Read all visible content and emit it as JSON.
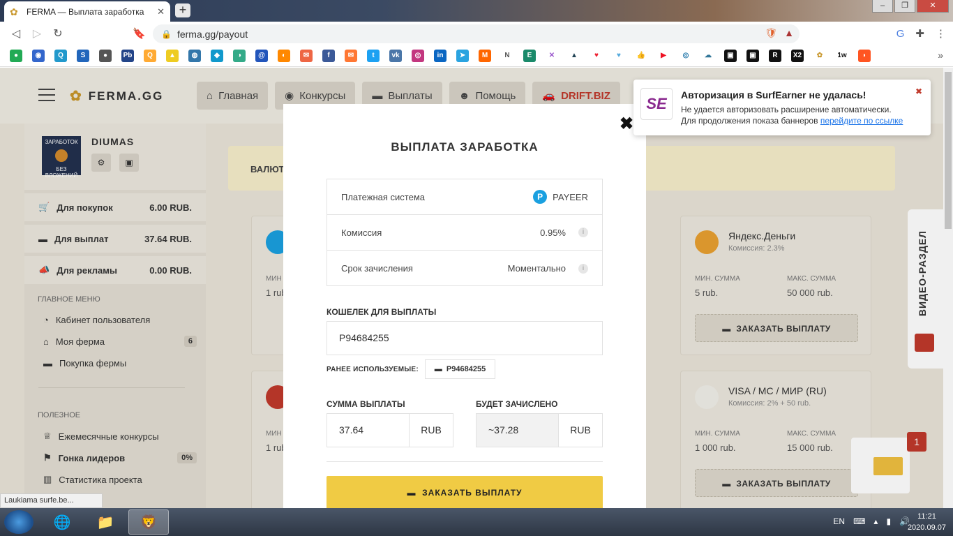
{
  "browser": {
    "tab_title": "FERMA — Выплата заработка",
    "url": "ferma.gg/payout",
    "status_text": "Laukiama surfe.be...",
    "brave_badge": "1"
  },
  "site": {
    "logo": "FERMA.GG",
    "nav": [
      "Главная",
      "Конкурсы",
      "Выплаты",
      "Помощь",
      "DRIFT.BIZ"
    ]
  },
  "sidebar": {
    "username": "DIUMAS",
    "avatar_text": "ЗАРАБОТОК",
    "avatar_sub": "БЕЗ ВЛОЖЕНИЙ",
    "balances": [
      {
        "label": "Для покупок",
        "value": "6.00 RUB."
      },
      {
        "label": "Для выплат",
        "value": "37.64 RUB."
      },
      {
        "label": "Для рекламы",
        "value": "0.00 RUB."
      }
    ],
    "main_menu_head": "ГЛАВНОЕ МЕНЮ",
    "main_menu": [
      {
        "label": "Кабинет пользователя",
        "badge": ""
      },
      {
        "label": "Моя ферма",
        "badge": "6"
      },
      {
        "label": "Покупка фермы",
        "badge": ""
      }
    ],
    "useful_head": "ПОЛЕЗНОЕ",
    "useful": [
      {
        "label": "Ежемесячные конкурсы",
        "badge": ""
      },
      {
        "label": "Гонка лидеров",
        "badge": "0%"
      },
      {
        "label": "Статистика проекта",
        "badge": ""
      }
    ]
  },
  "content": {
    "currency_label": "ВАЛЮТ",
    "cards": [
      {
        "name": "Яндекс.Деньги",
        "fee": "Комиссия: 2.3%",
        "min_label": "МИН. СУММА",
        "min": "5 rub.",
        "max_label": "МАКС. СУММА",
        "max": "50 000 rub.",
        "button": "ЗАКАЗАТЬ ВЫПЛАТУ"
      },
      {
        "name": "VISA / MC / МИР (RU)",
        "fee": "Комиссия: 2% + 50 rub.",
        "min_label": "МИН. СУММА",
        "min": "1 000 rub.",
        "max_label": "МАКС. СУММА",
        "max": "15 000 rub.",
        "button": "ЗАКАЗАТЬ ВЫПЛАТУ"
      }
    ],
    "partial_cards": [
      {
        "min_label": "МИН",
        "min": "1 rub"
      },
      {
        "min_label": "МИН",
        "min": "1 rub"
      }
    ],
    "video_tab": "ВИДЕО-РАЗДЕЛ",
    "message_count": "1"
  },
  "modal": {
    "title": "ВЫПЛАТА ЗАРАБОТКА",
    "rows": [
      {
        "key": "Платежная система",
        "value": "PAYEER"
      },
      {
        "key": "Комиссия",
        "value": "0.95%"
      },
      {
        "key": "Срок зачисления",
        "value": "Моментально"
      }
    ],
    "wallet_label": "КОШЕЛЕК ДЛЯ ВЫПЛАТЫ",
    "wallet_value": "P94684255",
    "prev_label": "РАНЕЕ ИСПОЛЬЗУЕМЫЕ:",
    "prev_value": "P94684255",
    "sum_label": "СУММА ВЫПЛАТЫ",
    "sum_value": "37.64",
    "sum_currency": "RUB",
    "credited_label": "БУДЕТ ЗАЧИСЛЕНО",
    "credited_value": "~37.28",
    "credited_currency": "RUB",
    "submit": "ЗАКАЗАТЬ ВЫПЛАТУ"
  },
  "notification": {
    "title": "Авторизация в SurfEarner не удалась!",
    "line1": "Не удается авторизовать расширение автоматически.",
    "line2": "Для продолжения показа баннеров",
    "link": "перейдите по ссылке",
    "icon_text": "SE"
  },
  "taskbar": {
    "lang": "EN",
    "time": "11:21",
    "date": "2020.09.07"
  }
}
